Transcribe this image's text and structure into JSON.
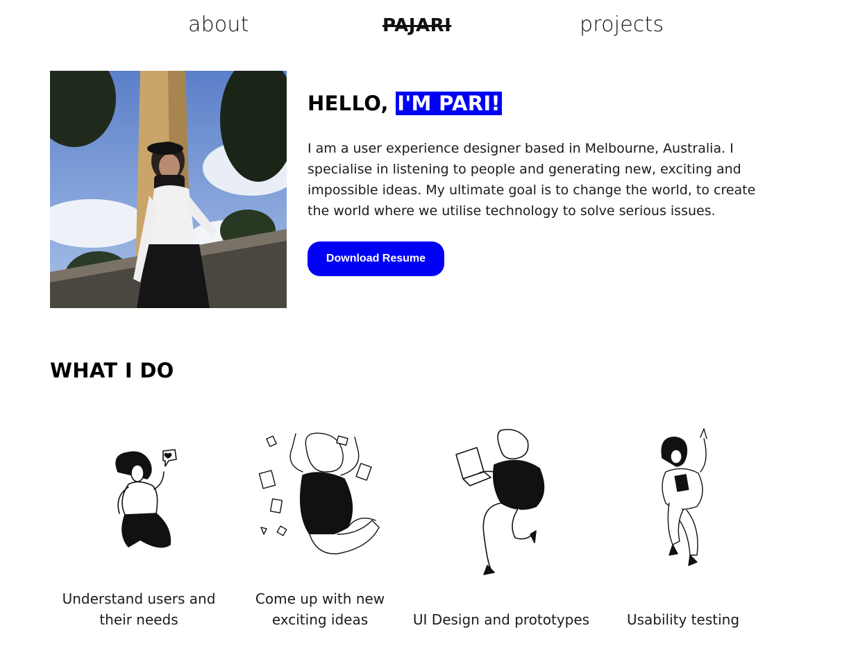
{
  "nav": {
    "about": "about",
    "logo": "PAJARI",
    "projects": "projects"
  },
  "hero": {
    "hello_prefix": "HELLO, ",
    "hello_highlight": "I'M PARI!",
    "bio": "I am a user experience designer based in Melbourne, Australia. I specialise in listening to people and generating new, exciting and impossible ideas. My ultimate goal is to change the world, to create the world where we utilise technology to solve serious issues.",
    "button": "Download Resume"
  },
  "what_i_do": {
    "title": "WHAT I DO",
    "items": [
      {
        "label": "Understand users and their needs",
        "icon": "user-research-illustration"
      },
      {
        "label": "Come up with new exciting ideas",
        "icon": "ideation-illustration"
      },
      {
        "label": "UI Design and prototypes",
        "icon": "ui-design-illustration"
      },
      {
        "label": "Usability testing",
        "icon": "usability-testing-illustration"
      }
    ]
  },
  "colors": {
    "accent": "#0000f5",
    "text": "#111111",
    "background": "#ffffff"
  }
}
